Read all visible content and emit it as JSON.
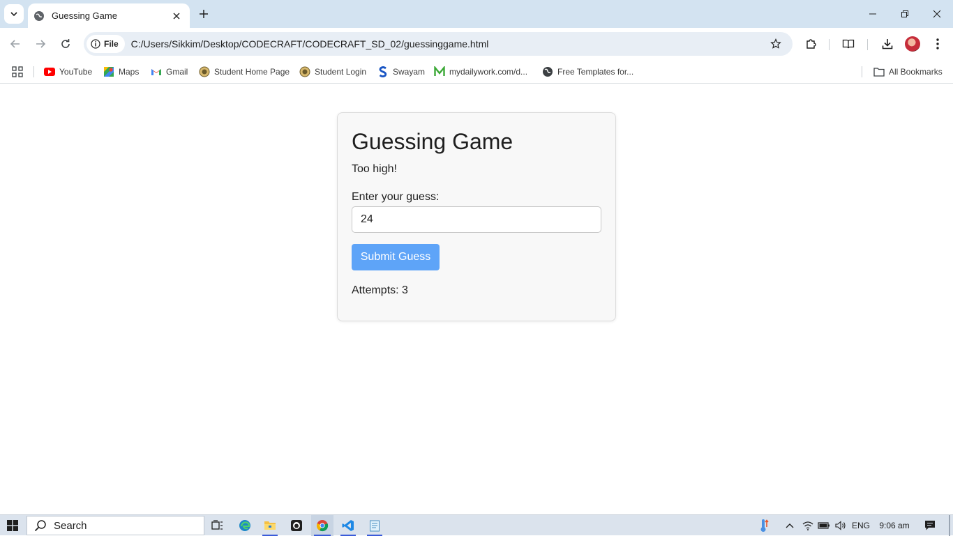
{
  "browser": {
    "tab_title": "Guessing Game",
    "omnibox_chip": "File",
    "url": "C:/Users/Sikkim/Desktop/CODECRAFT/CODECRAFT_SD_02/guessinggame.html"
  },
  "bookmarks": {
    "items": [
      {
        "label": "YouTube",
        "icon": "youtube-icon"
      },
      {
        "label": "Maps",
        "icon": "maps-icon"
      },
      {
        "label": "Gmail",
        "icon": "gmail-icon"
      },
      {
        "label": "Student Home Page",
        "icon": "seal-icon"
      },
      {
        "label": "Student Login",
        "icon": "seal-icon"
      },
      {
        "label": "Swayam",
        "icon": "swayam-icon"
      },
      {
        "label": "mydailywork.com/d...",
        "icon": "mydailywork-icon"
      },
      {
        "label": "Free Templates for...",
        "icon": "globe-icon"
      }
    ],
    "all_bookmarks": "All Bookmarks"
  },
  "game": {
    "title": "Guessing Game",
    "feedback": "Too high!",
    "input_label": "Enter your guess:",
    "input_value": "24",
    "submit_label": "Submit Guess",
    "attempts": "Attempts: 3"
  },
  "taskbar": {
    "search_placeholder": "Search",
    "language": "ENG",
    "time": "9:06 am"
  },
  "colors": {
    "tabbar": "#d3e3f1",
    "button": "#5ea4f8",
    "card": "#f8f8f8"
  }
}
